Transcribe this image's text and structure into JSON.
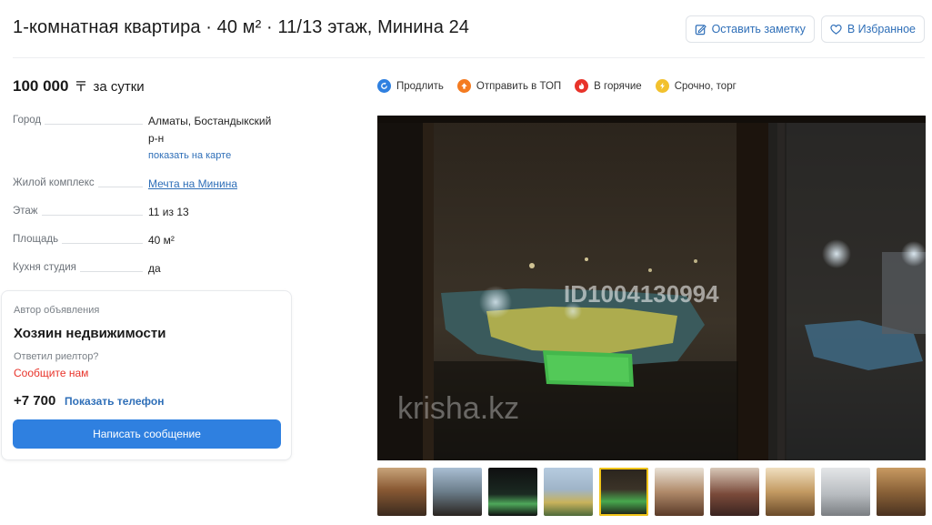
{
  "listing": {
    "title": "1-комнатная квартира · 40 м² · 11/13 этаж, Минина 24"
  },
  "actions": {
    "note_label": "Оставить заметку",
    "favorite_label": "В Избранное"
  },
  "price": {
    "amount": "100 000",
    "currency": "〒",
    "period": "за сутки"
  },
  "params": {
    "city_label": "Город",
    "city_value_1": "Алматы, Бостандыкский",
    "city_value_2": "р-н",
    "map_link": "показать на карте",
    "complex_label": "Жилой комплекс",
    "complex_value": "Мечта на Минина",
    "floor_label": "Этаж",
    "floor_value": "11 из 13",
    "area_label": "Площадь",
    "area_value": "40 м²",
    "kitchen_label": "Кухня студия",
    "kitchen_value": "да"
  },
  "author": {
    "caption": "Автор объявления",
    "name": "Хозяин недвижимости",
    "realtor_question": "Ответил риелтор?",
    "report_link": "Сообщите нам",
    "phone": "+7 700",
    "show_phone": "Показать телефон",
    "message_button": "Написать сообщение"
  },
  "promo": {
    "extend": "Продлить",
    "top": "Отправить в ТОП",
    "hot": "В горячие",
    "urgent": "Срочно, торг"
  },
  "photo": {
    "watermark_id": "ID1004130994",
    "watermark_site": "krisha.kz"
  },
  "colors": {
    "accent": "#2f80e0",
    "link": "#2f6fb8",
    "warning": "#e8332a",
    "promo_extend": "#2f80e0",
    "promo_top": "#f47b20",
    "promo_hot": "#e8332a",
    "promo_urgent": "#f2c12e"
  }
}
